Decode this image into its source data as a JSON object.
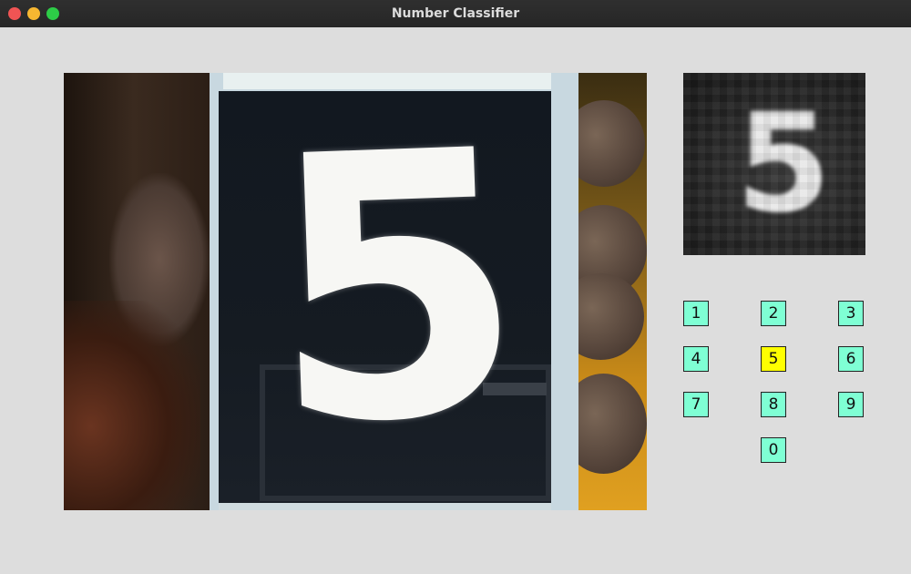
{
  "window": {
    "title": "Number Classifier"
  },
  "camera": {
    "shown_digit": "5"
  },
  "preview": {
    "processed_digit": "5"
  },
  "digits": [
    {
      "label": "1",
      "active": false
    },
    {
      "label": "2",
      "active": false
    },
    {
      "label": "3",
      "active": false
    },
    {
      "label": "4",
      "active": false
    },
    {
      "label": "5",
      "active": true
    },
    {
      "label": "6",
      "active": false
    },
    {
      "label": "7",
      "active": false
    },
    {
      "label": "8",
      "active": false
    },
    {
      "label": "9",
      "active": false
    },
    {
      "label": "0",
      "active": false
    }
  ],
  "colors": {
    "button_default": "#7fffd4",
    "button_active": "#ffff00"
  }
}
